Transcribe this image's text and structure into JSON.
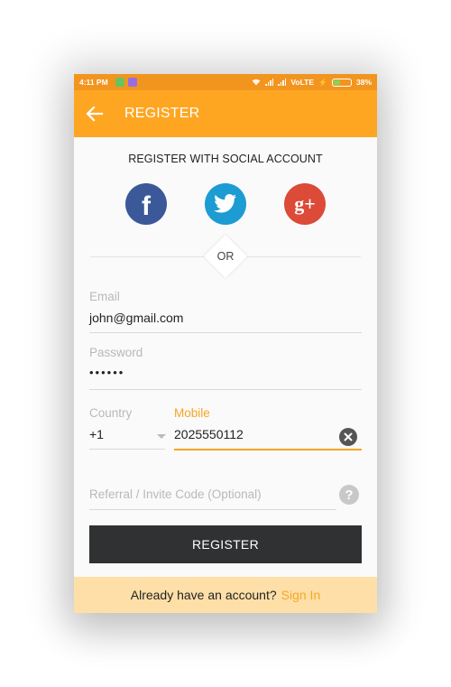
{
  "status_bar": {
    "time": "4:11 PM",
    "network": "VoLTE",
    "battery": "38%",
    "icons": [
      "app-notification-icon",
      "app-notification-icon",
      "wifi-icon",
      "signal-icon",
      "signal-icon",
      "charging-icon",
      "battery-icon"
    ]
  },
  "app_bar": {
    "title": "REGISTER",
    "back_icon": "arrow-left-icon"
  },
  "social": {
    "title": "REGISTER WITH SOCIAL ACCOUNT",
    "facebook_glyph": "f",
    "google_glyph": "g+",
    "colors": {
      "facebook": "#3b5998",
      "twitter": "#1d9bd3",
      "google": "#dc4a38"
    }
  },
  "divider": {
    "or_label": "OR"
  },
  "form": {
    "email": {
      "label": "Email",
      "value": "john@gmail.com"
    },
    "password": {
      "label": "Password",
      "value": "••••••"
    },
    "country": {
      "label": "Country",
      "value": "+1"
    },
    "mobile": {
      "label": "Mobile",
      "value": "2025550112"
    },
    "referral": {
      "placeholder": "Referral / Invite Code (Optional)"
    },
    "help_glyph": "?"
  },
  "register_button": {
    "label": "REGISTER"
  },
  "footer": {
    "text": "Already have an account?",
    "link": "Sign In"
  },
  "colors": {
    "accent": "#fea622",
    "status_bar": "#f2951f",
    "active_field": "#f5a623",
    "button": "#2f3133",
    "footer_bg": "#fedfa8"
  }
}
